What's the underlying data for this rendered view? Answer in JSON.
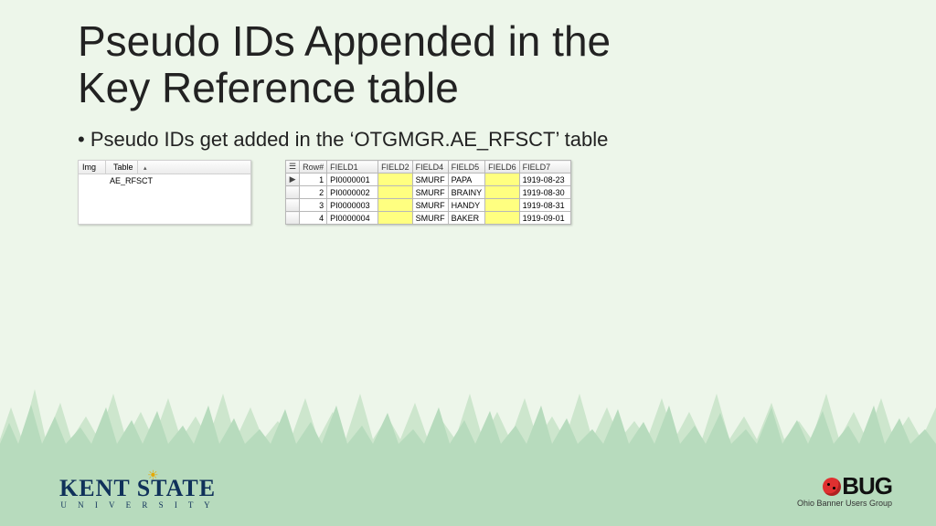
{
  "title_line1": "Pseudo IDs Appended in the",
  "title_line2": "Key Reference table",
  "bullet_text": "Pseudo IDs get added in the ‘OTGMGR.AE_RFSCT’ table",
  "left_panel": {
    "col_img": "Img",
    "col_table": "Table",
    "sort_glyph": "▴",
    "row0": "AE_RFSCT"
  },
  "grid": {
    "corner_glyph": "☰",
    "headers": [
      "Row#",
      "FIELD1",
      "FIELD2",
      "FIELD4",
      "FIELD5",
      "FIELD6",
      "FIELD7"
    ],
    "pointer_glyph": "▶",
    "rows": [
      {
        "n": "1",
        "f1": "PI0000001",
        "f2": "",
        "f4": "SMURF",
        "f5": "PAPA",
        "f6": "",
        "f7": "1919-08-23"
      },
      {
        "n": "2",
        "f1": "PI0000002",
        "f2": "",
        "f4": "SMURF",
        "f5": "BRAINY",
        "f6": "",
        "f7": "1919-08-30"
      },
      {
        "n": "3",
        "f1": "PI0000003",
        "f2": "",
        "f4": "SMURF",
        "f5": "HANDY",
        "f6": "",
        "f7": "1919-08-31"
      },
      {
        "n": "4",
        "f1": "PI0000004",
        "f2": "",
        "f4": "SMURF",
        "f5": "BAKER",
        "f6": "",
        "f7": "1919-09-01"
      }
    ]
  },
  "kent": {
    "main": "KENT STATE",
    "sub": "U N I V E R S I T Y",
    "sun": "☀"
  },
  "obug": {
    "txt": "BUG",
    "sub": "Ohio Banner Users Group"
  }
}
